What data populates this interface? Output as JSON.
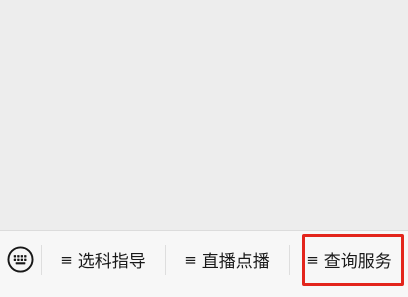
{
  "menu": {
    "keyboard_icon": "keyboard-icon",
    "items": [
      {
        "glyph": "≡",
        "label": "选科指导"
      },
      {
        "glyph": "≡",
        "label": "直播点播"
      },
      {
        "glyph": "≡",
        "label": "查询服务"
      }
    ],
    "highlighted_item": "查询服务",
    "highlight_color": "#e3251c"
  }
}
